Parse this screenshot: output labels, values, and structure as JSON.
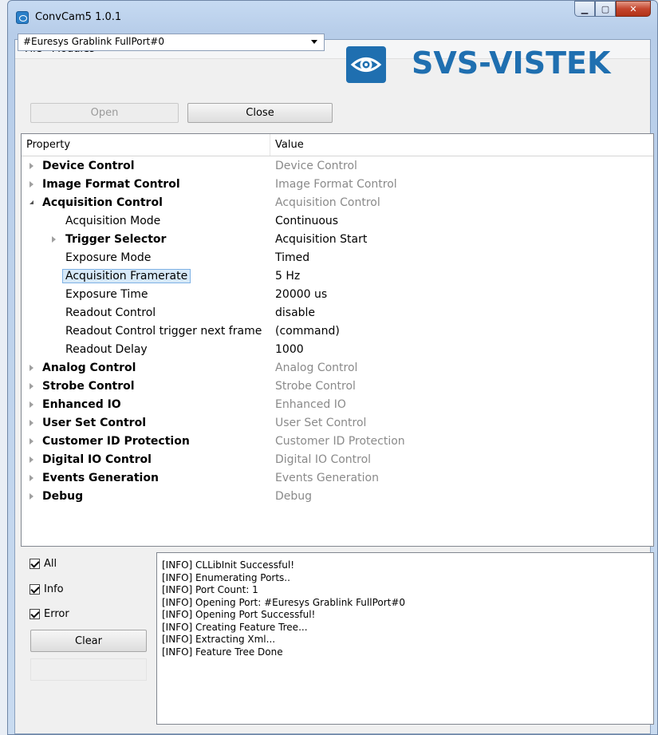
{
  "window": {
    "title": "ConvCam5 1.0.1"
  },
  "menu": [
    "File",
    "Modules"
  ],
  "port": {
    "selected": "#Euresys Grablink FullPort#0"
  },
  "buttons": {
    "open": "Open",
    "close": "Close",
    "clear": "Clear"
  },
  "logo": {
    "text": "SVS-VISTEK",
    "brand_color": "#1f6fb0"
  },
  "tree": {
    "headers": {
      "property": "Property",
      "value": "Value"
    },
    "rows": [
      {
        "label": "Device Control",
        "value": "Device Control",
        "level": 0,
        "expander": "closed",
        "bold": true,
        "grey": true
      },
      {
        "label": "Image Format Control",
        "value": "Image Format Control",
        "level": 0,
        "expander": "closed",
        "bold": true,
        "grey": true
      },
      {
        "label": "Acquisition Control",
        "value": "Acquisition Control",
        "level": 0,
        "expander": "open",
        "bold": true,
        "grey": true
      },
      {
        "label": "Acquisition Mode",
        "value": "Continuous",
        "level": 1,
        "expander": "none",
        "bold": false,
        "grey": false
      },
      {
        "label": "Trigger Selector",
        "value": "Acquisition Start",
        "level": 1,
        "expander": "closed",
        "bold": true,
        "grey": false
      },
      {
        "label": "Exposure Mode",
        "value": "Timed",
        "level": 1,
        "expander": "none",
        "bold": false,
        "grey": false
      },
      {
        "label": "Acquisition Framerate",
        "value": "5 Hz",
        "level": 1,
        "expander": "none",
        "bold": false,
        "grey": false,
        "selected": true
      },
      {
        "label": "Exposure Time",
        "value": "20000 us",
        "level": 1,
        "expander": "none",
        "bold": false,
        "grey": false
      },
      {
        "label": "Readout Control",
        "value": "disable",
        "level": 1,
        "expander": "none",
        "bold": false,
        "grey": false
      },
      {
        "label": "Readout Control trigger next frame",
        "value": "(command)",
        "level": 1,
        "expander": "none",
        "bold": false,
        "grey": false
      },
      {
        "label": "Readout Delay",
        "value": "1000",
        "level": 1,
        "expander": "none",
        "bold": false,
        "grey": false
      },
      {
        "label": "Analog Control",
        "value": "Analog Control",
        "level": 0,
        "expander": "closed",
        "bold": true,
        "grey": true
      },
      {
        "label": "Strobe Control",
        "value": "Strobe Control",
        "level": 0,
        "expander": "closed",
        "bold": true,
        "grey": true
      },
      {
        "label": "Enhanced IO",
        "value": "Enhanced IO",
        "level": 0,
        "expander": "closed",
        "bold": true,
        "grey": true
      },
      {
        "label": "User Set Control",
        "value": "User Set Control",
        "level": 0,
        "expander": "closed",
        "bold": true,
        "grey": true
      },
      {
        "label": "Customer ID Protection",
        "value": "Customer ID Protection",
        "level": 0,
        "expander": "closed",
        "bold": true,
        "grey": true
      },
      {
        "label": "Digital IO Control",
        "value": "Digital IO Control",
        "level": 0,
        "expander": "closed",
        "bold": true,
        "grey": true
      },
      {
        "label": "Events Generation",
        "value": "Events Generation",
        "level": 0,
        "expander": "closed",
        "bold": true,
        "grey": true
      },
      {
        "label": "Debug",
        "value": "Debug",
        "level": 0,
        "expander": "closed",
        "bold": true,
        "grey": true
      }
    ]
  },
  "filters": {
    "all": "All",
    "info": "Info",
    "error": "Error"
  },
  "log": [
    "[INFO] CLLibInit Successful!",
    "[INFO] Enumerating Ports..",
    "[INFO] Port Count: 1",
    "[INFO] Opening Port: #Euresys Grablink FullPort#0",
    "[INFO] Opening Port Successful!",
    "[INFO] Creating Feature Tree...",
    "[INFO] Extracting Xml...",
    "[INFO] Feature Tree Done"
  ]
}
